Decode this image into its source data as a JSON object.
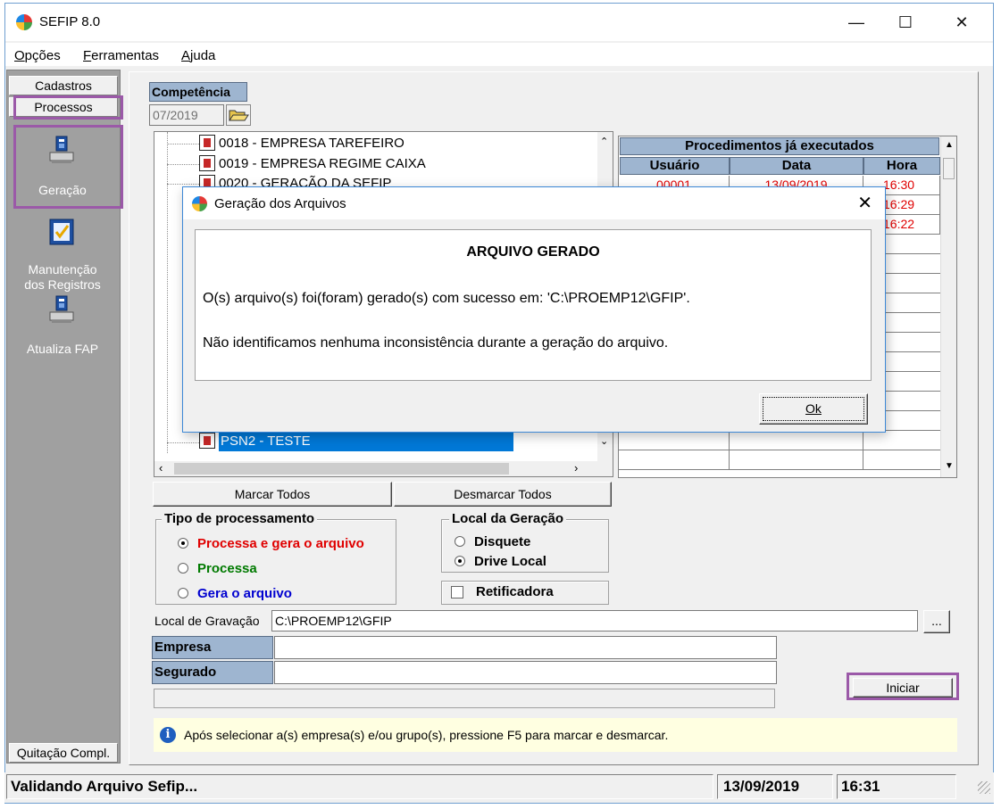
{
  "window": {
    "title": "SEFIP 8.0",
    "minimize": "—",
    "maximize": "☐",
    "close": "✕"
  },
  "menu": [
    {
      "label_first": "O",
      "label_rest": "pções"
    },
    {
      "label_first": "F",
      "label_rest": "erramentas"
    },
    {
      "label_first": "A",
      "label_rest": "juda"
    }
  ],
  "left_panel": {
    "tab_cadastros": "Cadastros",
    "tab_processos": "Processos",
    "items": [
      {
        "label": "Geração",
        "icon": "computer-disk-icon"
      },
      {
        "label_line1": "Manutenção",
        "label_line2": "dos Registros",
        "icon": "checklist-icon"
      },
      {
        "label": "Atualiza FAP",
        "icon": "computer-disk-icon"
      }
    ],
    "tab_quitacao": "Quitação Compl."
  },
  "competencia": {
    "label": "Competência",
    "value": "07/2019",
    "folder_icon": "open-folder-icon"
  },
  "tree": {
    "items": [
      "0018 - EMPRESA TAREFEIRO",
      "0019 - EMPRESA REGIME CAIXA",
      "0020 - GERAÇÃO DA SEFIP"
    ],
    "selected_item": "PSN2 - TESTE"
  },
  "procedimentos": {
    "title": "Procedimentos já executados",
    "columns": [
      "Usuário",
      "Data",
      "Hora"
    ],
    "rows": [
      {
        "usuario": "00001",
        "data": "13/09/2019",
        "hora": "16:30"
      },
      {
        "usuario": "",
        "data": "",
        "hora": "16:29"
      },
      {
        "usuario": "",
        "data": "",
        "hora": "16:22"
      }
    ]
  },
  "buttons": {
    "marcar_todos": "Marcar Todos",
    "desmarcar_todos": "Desmarcar Todos",
    "browse": "...",
    "iniciar": "Iniciar"
  },
  "tipo_processamento": {
    "title": "Tipo de processamento",
    "options": [
      {
        "label": "Processa e gera o arquivo",
        "selected": true,
        "color": "#e00000"
      },
      {
        "label": "Processa",
        "selected": false,
        "color": "#007a00"
      },
      {
        "label": "Gera o arquivo",
        "selected": false,
        "color": "#0000d0"
      }
    ]
  },
  "local_geracao": {
    "title": "Local da Geração",
    "options": [
      {
        "label": "Disquete",
        "selected": false
      },
      {
        "label": "Drive Local",
        "selected": true
      }
    ]
  },
  "retificadora": {
    "label": "Retificadora",
    "checked": false
  },
  "local_gravacao": {
    "label": "Local de Gravação",
    "value": "C:\\PROEMP12\\GFIP"
  },
  "fields": {
    "empresa": "Empresa",
    "segurado": "Segurado"
  },
  "info": {
    "icon": "info-icon",
    "text": "Após selecionar a(s) empresa(s) e/ou grupo(s), pressione F5 para marcar e desmarcar."
  },
  "status": {
    "message": "Validando Arquivo Sefip...",
    "date": "13/09/2019",
    "time": "16:31"
  },
  "dialog": {
    "title": "Geração dos Arquivos",
    "close": "✕",
    "heading": "ARQUIVO GERADO",
    "line1": "O(s) arquivo(s) foi(foram) gerado(s) com sucesso em: 'C:\\PROEMP12\\GFIP'.",
    "line2": "Não identificamos nenhuma inconsistência durante a geração do arquivo.",
    "ok": "Ok"
  },
  "colors": {
    "highlight": "#9b59a8",
    "header_blue": "#9eb5d0",
    "selection": "#0078d7"
  }
}
